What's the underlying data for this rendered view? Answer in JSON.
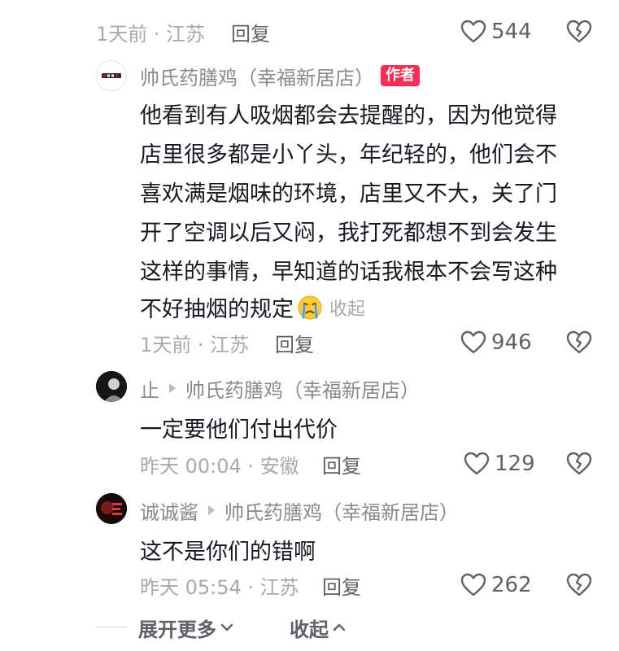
{
  "top_comment_footer": {
    "time_location": "1天前 · 江苏",
    "reply_label": "回复",
    "like_count": "544"
  },
  "author_reply": {
    "avatar_icon": "restaurant-logo-avatar",
    "username": "帅氏药膳鸡（幸福新居店）",
    "badge": "作者",
    "lines": [
      "他看到有人吸烟都会去提醒的，因为他觉得",
      "店里很多都是小丫头，年纪轻的，他们会不",
      "喜欢满是烟味的环境，店里又不大，关了门",
      "开了空调以后又闷，我打死都想不到会发生",
      "这样的事情，早知道的话我根本不会写这种",
      "不好抽烟的规定"
    ],
    "emoji_icon": "crying-face-icon",
    "collapse_label": "收起",
    "time_location": "1天前 · 江苏",
    "reply_label": "回复",
    "like_count": "946"
  },
  "reply_1": {
    "avatar_icon": "dark-portrait-avatar",
    "username": "止",
    "reply_to": "帅氏药膳鸡（幸福新居店）",
    "text": "一定要他们付出代价",
    "time_location": "昨天 00:04 · 安徽",
    "reply_label": "回复",
    "like_count": "129"
  },
  "reply_2": {
    "avatar_icon": "red-dark-portrait-avatar",
    "username": "诚诚酱",
    "reply_to": "帅氏药膳鸡（幸福新居店）",
    "text": "这不是你们的错啊",
    "time_location": "昨天 05:54 · 江苏",
    "reply_label": "回复",
    "like_count": "262"
  },
  "footer": {
    "expand_label": "展开更多",
    "collapse_label": "收起"
  },
  "colors": {
    "badge_red": "#fe2c55",
    "text_primary": "#161823",
    "text_meta": "#a8a9ad"
  }
}
